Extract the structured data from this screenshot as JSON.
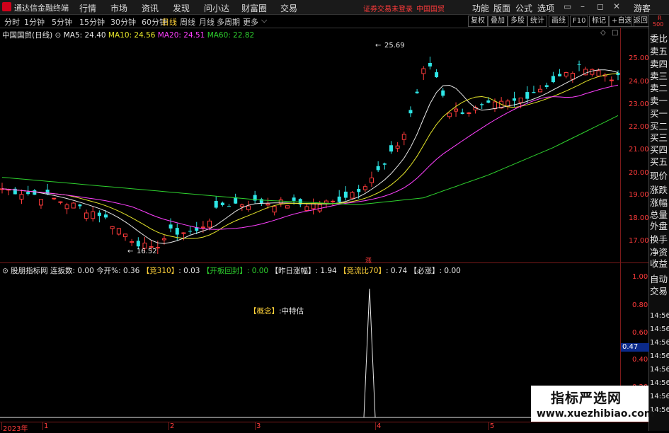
{
  "title_bar": {
    "app_name": "通达信金融终端",
    "menus": [
      "行情",
      "市场",
      "资讯",
      "发现",
      "问小达",
      "财富圈",
      "交易"
    ],
    "warning": "证券交易未登录",
    "stock_name": "中国国贸",
    "right_menus": [
      "功能",
      "版面",
      "公式",
      "选项"
    ],
    "user": "游客"
  },
  "toolbar": {
    "periods": [
      "分时",
      "1分钟",
      "5分钟",
      "15分钟",
      "30分钟",
      "60分钟",
      "日线",
      "周线",
      "月线",
      "多周期",
      "更多"
    ],
    "selected": "日线",
    "buttons": [
      "复权",
      "叠加",
      "多股",
      "统计",
      "画线",
      "F10",
      "标记",
      "+自选",
      "返回"
    ]
  },
  "right_panel": {
    "top": [
      "R",
      "500"
    ],
    "items": [
      "委比",
      "卖五",
      "卖四",
      "卖三",
      "卖二",
      "卖一",
      "买一",
      "买二",
      "买三",
      "买四",
      "买五",
      "现价",
      "涨跌",
      "涨幅",
      "总量",
      "外盘",
      "换手",
      "净资",
      "收益",
      "自动",
      "交易"
    ],
    "times": [
      "14:56",
      "14:56",
      "14:56",
      "14:56",
      "14:56",
      "14:56",
      "14:56",
      "14:56"
    ]
  },
  "chart_header": {
    "name": "中国国贸(日线)",
    "ma5": "MA5: 24.40",
    "ma10": "MA10: 24.56",
    "ma20": "MA20: 24.51",
    "ma60": "MA60: 22.82"
  },
  "chart_data": {
    "type": "candlestick",
    "y_ticks": [
      "25.00",
      "24.00",
      "23.00",
      "22.00",
      "21.00",
      "20.00",
      "19.00",
      "18.00",
      "17.00"
    ],
    "high_label": "25.69",
    "low_label": "16.52",
    "x_labels": [
      "2023年",
      "1",
      "2",
      "3",
      "4",
      "5"
    ],
    "colors": {
      "up": "#ff3b3b",
      "down": "#2ee6e6",
      "ma5": "#e8e8e8",
      "ma10": "#e6e62a",
      "ma20": "#ff40ff",
      "ma60": "#2ed12e"
    }
  },
  "indicator": {
    "name": "股朋指标网",
    "lianban": "连扳数: 0.00",
    "jinkai": "今开%: 0.36",
    "jing310_label": "【竞310】",
    "jing310_val": ": 0.03",
    "kaiban_label": "【开板回封】",
    "kaiban_val": ": 0.00",
    "zuori_label": "【昨日涨幅】",
    "zuori_val": ": 1.94",
    "jingliu_label": "【竞流比70】",
    "jingliu_val": ": 0.74",
    "bizhang_label": "【必涨】",
    "bizhang_val": ": 0.00",
    "y_ticks": [
      "1.00",
      "0.80",
      "0.60",
      "0.40",
      "0.20"
    ],
    "current_value": "0.47",
    "concept_label": "【概念】",
    "concept_val": ":中特估",
    "zhang_mark": "涨"
  },
  "watermark": {
    "line1": "指标严选网",
    "line2": "www.xuezhibiao.com"
  }
}
